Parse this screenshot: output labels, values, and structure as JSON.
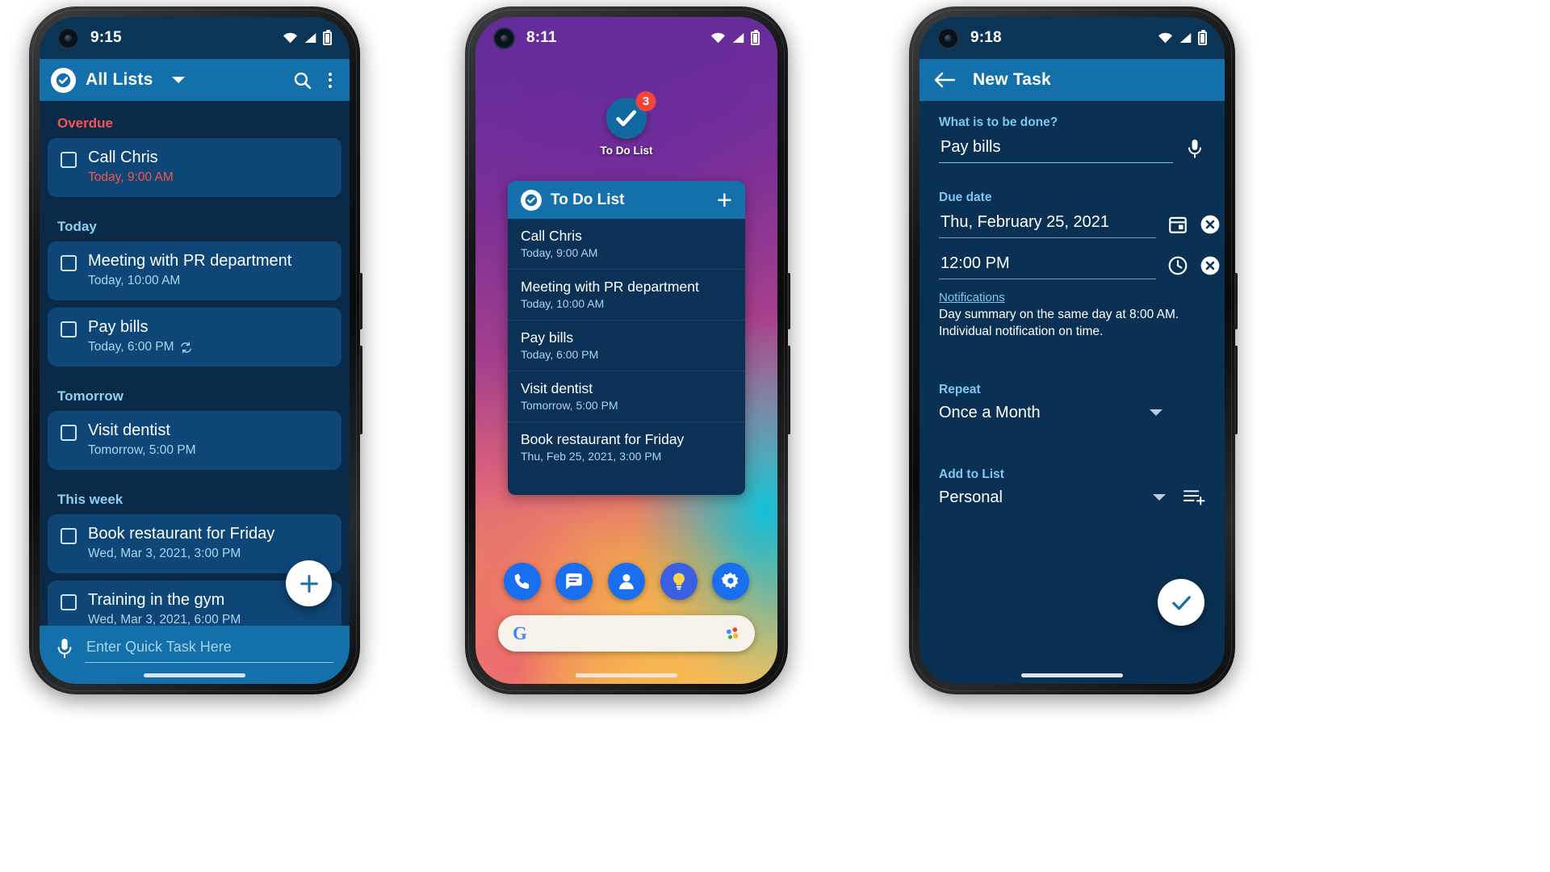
{
  "colors": {
    "appbar": "#1470ab",
    "screen_bg": "#0a2a47",
    "card": "#0e4677",
    "overdue": "#f4554f",
    "accent_light": "#7ec8ef",
    "badge_red": "#f0453c"
  },
  "phone1": {
    "status": {
      "time": "9:15",
      "wifi": "wifi-icon",
      "signal": "signal-icon",
      "battery": "battery-icon"
    },
    "appbar": {
      "logo": "check-circle-icon",
      "title": "All Lists",
      "dropdown": "chevron-down-icon",
      "search": "search-icon",
      "overflow": "more-vertical-icon"
    },
    "sections": [
      {
        "label": "Overdue",
        "style": "overdue",
        "tasks": [
          {
            "title": "Call Chris",
            "sub": "Today, 9:00 AM",
            "sub_style": "red",
            "repeat": false
          }
        ]
      },
      {
        "label": "Today",
        "style": "normal",
        "tasks": [
          {
            "title": "Meeting with PR department",
            "sub": "Today, 10:00 AM",
            "sub_style": "blue",
            "repeat": false
          },
          {
            "title": "Pay bills",
            "sub": "Today, 6:00 PM",
            "sub_style": "blue",
            "repeat": true
          }
        ]
      },
      {
        "label": "Tomorrow",
        "style": "normal",
        "tasks": [
          {
            "title": "Visit dentist",
            "sub": "Tomorrow, 5:00 PM",
            "sub_style": "blue",
            "repeat": false
          }
        ]
      },
      {
        "label": "This week",
        "style": "normal",
        "tasks": [
          {
            "title": "Book restaurant for Friday",
            "sub": "Wed, Mar 3, 2021, 3:00 PM",
            "sub_style": "blue",
            "repeat": false
          },
          {
            "title": "Training in the gym",
            "sub": "Wed, Mar 3, 2021, 6:00 PM",
            "sub_style": "blue",
            "repeat": false
          }
        ]
      }
    ],
    "fab": {
      "icon": "plus-icon"
    },
    "quickbar": {
      "mic": "microphone-icon",
      "placeholder": "Enter Quick Task Here",
      "value": ""
    }
  },
  "phone2": {
    "status": {
      "time": "8:11",
      "wifi": "wifi-icon",
      "signal": "signal-icon",
      "battery": "battery-icon"
    },
    "home_icon": {
      "label": "To Do List",
      "badge": "3",
      "glyph": "check-circle-icon"
    },
    "widget": {
      "logo": "check-circle-icon",
      "title": "To Do List",
      "add": "plus-icon",
      "rows": [
        {
          "title": "Call Chris",
          "sub": "Today, 9:00 AM"
        },
        {
          "title": "Meeting with PR department",
          "sub": "Today, 10:00 AM"
        },
        {
          "title": "Pay bills",
          "sub": "Today, 6:00 PM"
        },
        {
          "title": "Visit dentist",
          "sub": "Tomorrow, 5:00 PM"
        },
        {
          "title": "Book restaurant for Friday",
          "sub": "Thu, Feb 25, 2021, 3:00 PM"
        }
      ]
    },
    "dock": [
      {
        "name": "phone-icon"
      },
      {
        "name": "messages-icon"
      },
      {
        "name": "contacts-icon"
      },
      {
        "name": "assistant-icon"
      },
      {
        "name": "settings-gear-icon"
      }
    ],
    "search": {
      "logo": "google-logo",
      "logo_text": "G",
      "voice": "google-mic-icon"
    }
  },
  "phone3": {
    "status": {
      "time": "9:18",
      "wifi": "wifi-icon",
      "signal": "signal-icon",
      "battery": "battery-icon"
    },
    "appbar": {
      "back": "back-arrow-icon",
      "title": "New Task"
    },
    "task": {
      "label": "What is to be done?",
      "value": "Pay bills",
      "mic": "microphone-icon"
    },
    "due": {
      "label": "Due date",
      "date_value": "Thu, February 25, 2021",
      "date_icon": "calendar-icon",
      "date_clear": "clear-circle-icon",
      "time_value": "12:00 PM",
      "time_icon": "clock-icon",
      "time_clear": "clear-circle-icon"
    },
    "notifications": {
      "link": "Notifications",
      "line1": "Day summary on the same day at 8:00 AM.",
      "line2": "Individual notification on time."
    },
    "repeat": {
      "label": "Repeat",
      "value": "Once a Month",
      "caret": "chevron-down-icon"
    },
    "add_to_list": {
      "label": "Add to List",
      "value": "Personal",
      "caret": "chevron-down-icon",
      "list_icon": "add-to-list-icon"
    },
    "save": {
      "icon": "check-icon"
    }
  }
}
